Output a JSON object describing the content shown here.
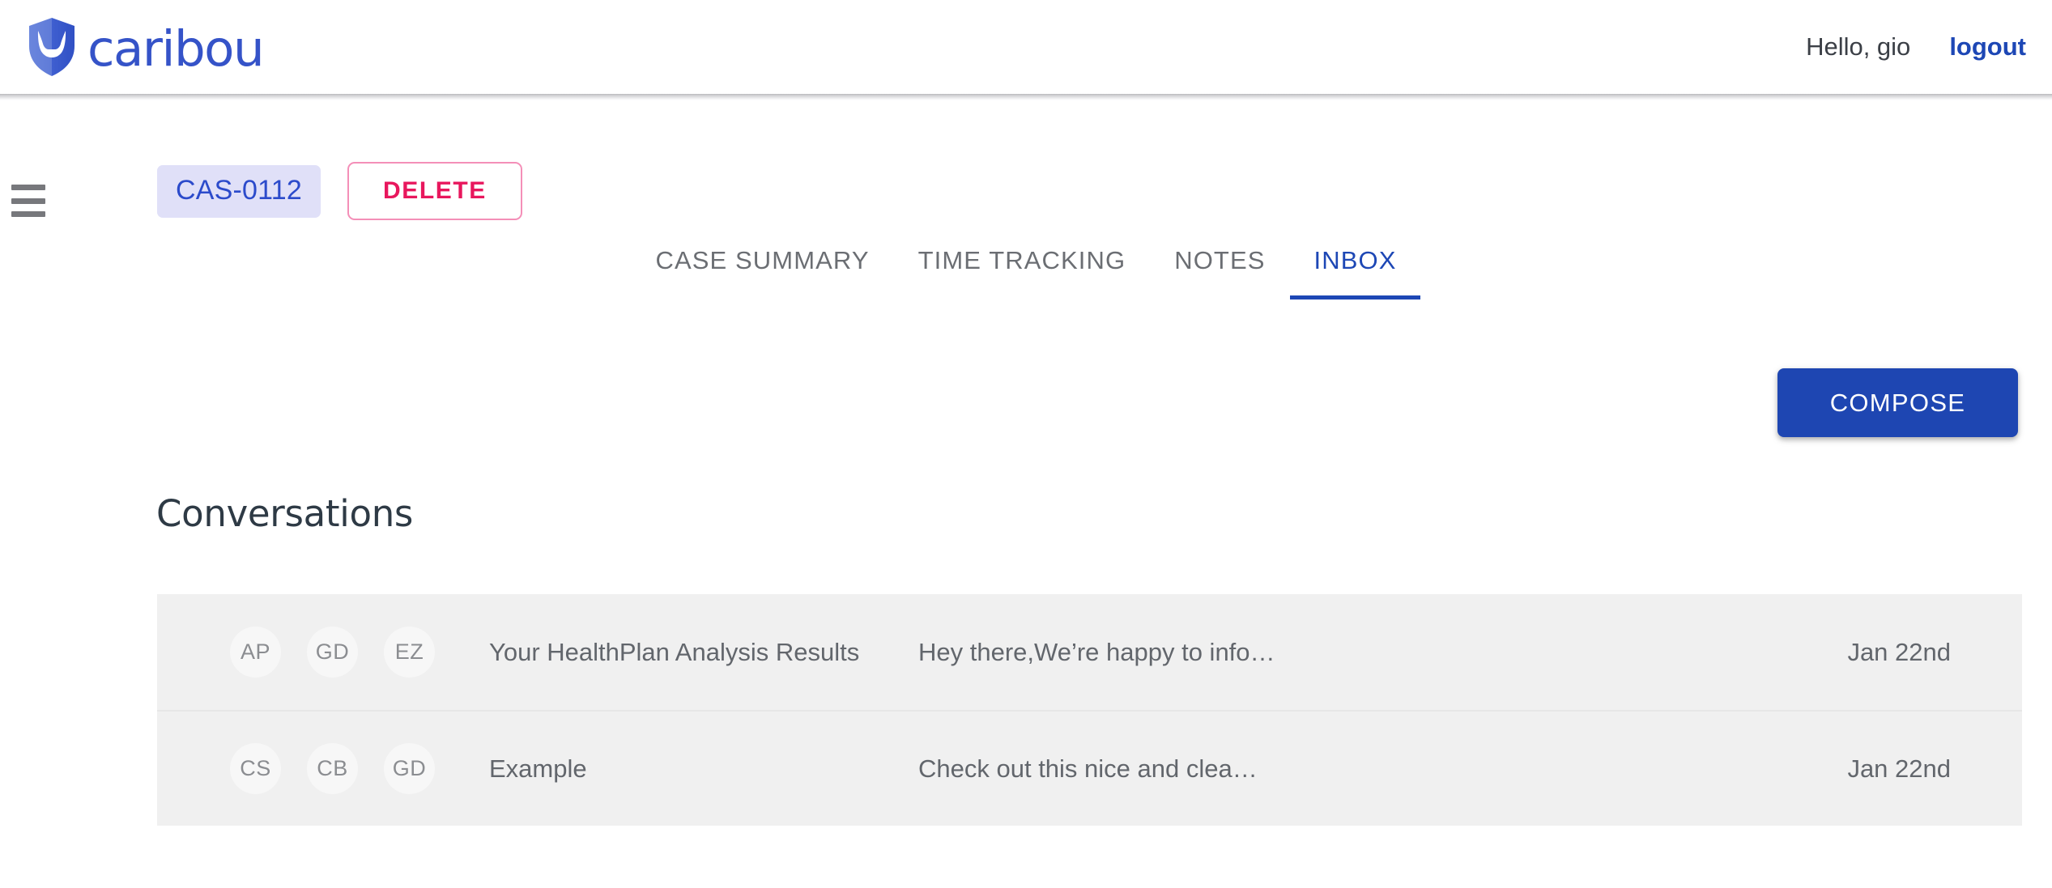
{
  "header": {
    "brand_name": "caribou",
    "brand_icon": "shield-antlers-logo",
    "greeting": "Hello, gio",
    "logout_label": "logout",
    "brand_color": "#3553c8",
    "link_color": "#1d47b5"
  },
  "menu": {
    "toggle_icon": "hamburger-menu-icon"
  },
  "case_bar": {
    "case_id": "CAS-0112",
    "delete_label": "DELETE",
    "badge_bg": "#e0e0f8",
    "badge_text_color": "#2c4bcb",
    "delete_color": "#e8175d",
    "delete_border_color": "#f48fb8"
  },
  "tabs": {
    "items": [
      {
        "label": "CASE SUMMARY",
        "active": false
      },
      {
        "label": "TIME TRACKING",
        "active": false
      },
      {
        "label": "NOTES",
        "active": false
      },
      {
        "label": "INBOX",
        "active": true
      }
    ],
    "active_color": "#1d47b5",
    "inactive_color": "#6b6e73"
  },
  "actions": {
    "compose_label": "COMPOSE",
    "compose_bg": "#1e46b2",
    "compose_text_color": "#ffffff"
  },
  "conversations": {
    "title": "Conversations",
    "row_bg": "#f0f0f0",
    "avatar_bg": "#f7f7f7",
    "text_color": "#62666c",
    "rows": [
      {
        "avatars": [
          "AP",
          "GD",
          "EZ"
        ],
        "subject": "Your HealthPlan Analysis Results",
        "preview": "Hey there,We’re happy to info…",
        "date": "Jan 22nd"
      },
      {
        "avatars": [
          "CS",
          "CB",
          "GD"
        ],
        "subject": "Example",
        "preview": "Check out this nice and clea…",
        "date": "Jan 22nd"
      }
    ]
  }
}
